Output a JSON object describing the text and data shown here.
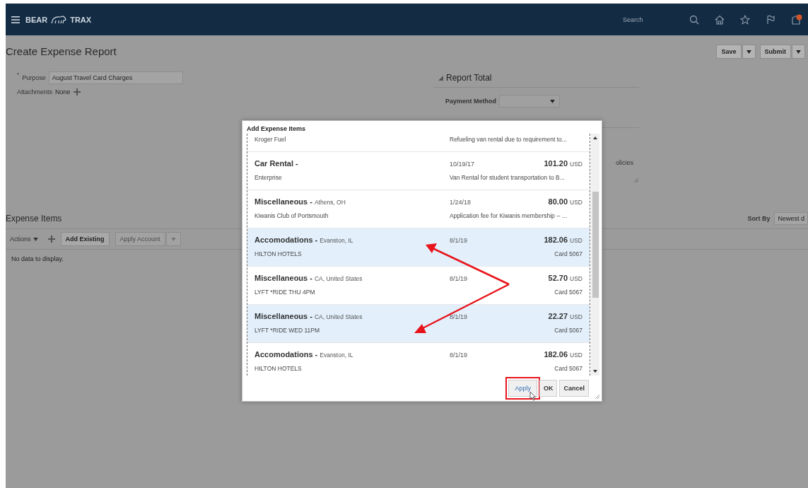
{
  "header": {
    "brand_left": "BEAR",
    "brand_right": "TRAX",
    "search": {
      "placeholder": "Search"
    }
  },
  "page": {
    "title": "Create Expense Report",
    "actions": [
      {
        "label": "Save"
      },
      {
        "label": "Submit"
      }
    ]
  },
  "form": {
    "purpose": {
      "mark": "*",
      "label": "Purpose",
      "value": "August Travel Card Charges"
    },
    "attachments": {
      "label": "Attachments",
      "value": "None"
    }
  },
  "report_total": {
    "title": "Report Total",
    "payment_method": {
      "label": "Payment Method"
    },
    "partial_text": "olicies"
  },
  "expense_items": {
    "title": "Expense Items",
    "sort": {
      "label": "Sort By",
      "value": "Newest d"
    },
    "toolbar": {
      "actions": "Actions",
      "add_existing": "Add Existing",
      "apply_account": "Apply Account",
      "apply_account_disabled": true
    },
    "empty": "No data to display."
  },
  "dialog": {
    "title": "Add Expense Items",
    "items": [
      {
        "merchant": "Kroger Fuel",
        "description": "Refueling van rental due to requirement to...",
        "selected": false
      },
      {
        "category": "Car Rental -",
        "merchant": "Enterprise",
        "date": "10/19/17",
        "amount": "101.20",
        "currency": "USD",
        "description": "Van Rental for student transportation to B...",
        "selected": false
      },
      {
        "category": "Miscellaneous -",
        "location": "Athens, OH",
        "merchant": "Kiwanis Club of Portsmouth",
        "date": "1/24/18",
        "amount": "80.00",
        "currency": "USD",
        "description": "Application fee for Kiwanis membership -- ...",
        "selected": false
      },
      {
        "category": "Accomodations -",
        "location": "Evanston, IL",
        "merchant": "HILTON HOTELS",
        "date": "8/1/19",
        "amount": "182.06",
        "currency": "USD",
        "card": "Card 5067",
        "selected": true
      },
      {
        "category": "Miscellaneous -",
        "location": "CA, United States",
        "merchant": "LYFT *RIDE THU 4PM",
        "date": "8/1/19",
        "amount": "52.70",
        "currency": "USD",
        "card": "Card 5067",
        "selected": false
      },
      {
        "category": "Miscellaneous -",
        "location": "CA, United States",
        "merchant": "LYFT *RIDE WED 11PM",
        "date": "8/1/19",
        "amount": "22.27",
        "currency": "USD",
        "card": "Card 5067",
        "selected": true
      },
      {
        "category": "Accomodations -",
        "location": "Evanston, IL",
        "merchant": "HILTON HOTELS",
        "date": "8/1/19",
        "amount": "182.06",
        "currency": "USD",
        "card": "Card 5067",
        "selected": false
      }
    ],
    "buttons": [
      {
        "label": "Apply",
        "highlighted": true
      },
      {
        "label": "OK",
        "highlighted": false
      },
      {
        "label": "Cancel",
        "highlighted": false
      }
    ]
  }
}
